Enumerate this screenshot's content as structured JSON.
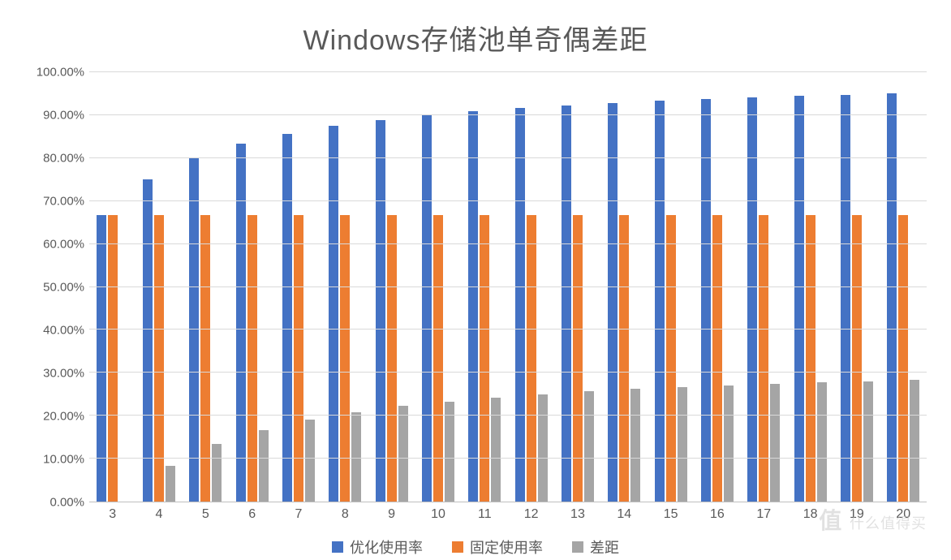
{
  "chart_data": {
    "type": "bar",
    "title": "Windows存储池单奇偶差距",
    "xlabel": "",
    "ylabel": "",
    "ylim": [
      0,
      100
    ],
    "y_ticks": [
      "0.00%",
      "10.00%",
      "20.00%",
      "30.00%",
      "40.00%",
      "50.00%",
      "60.00%",
      "70.00%",
      "80.00%",
      "90.00%",
      "100.00%"
    ],
    "categories": [
      "3",
      "4",
      "5",
      "6",
      "7",
      "8",
      "9",
      "10",
      "11",
      "12",
      "13",
      "14",
      "15",
      "16",
      "17",
      "18",
      "19",
      "20"
    ],
    "series": [
      {
        "name": "优化使用率",
        "color": "#4472c4",
        "values": [
          66.67,
          75.0,
          80.0,
          83.33,
          85.71,
          87.5,
          88.89,
          90.0,
          90.91,
          91.67,
          92.31,
          92.86,
          93.33,
          93.75,
          94.12,
          94.44,
          94.74,
          95.0
        ]
      },
      {
        "name": "固定使用率",
        "color": "#ed7d31",
        "values": [
          66.67,
          66.67,
          66.67,
          66.67,
          66.67,
          66.67,
          66.67,
          66.67,
          66.67,
          66.67,
          66.67,
          66.67,
          66.67,
          66.67,
          66.67,
          66.67,
          66.67,
          66.67
        ]
      },
      {
        "name": "差距",
        "color": "#a5a5a5",
        "values": [
          0.0,
          8.33,
          13.33,
          16.67,
          19.05,
          20.83,
          22.22,
          23.33,
          24.24,
          25.0,
          25.64,
          26.19,
          26.67,
          27.08,
          27.45,
          27.78,
          28.07,
          28.33
        ]
      }
    ],
    "legend_position": "bottom"
  },
  "watermark": {
    "brand": "值",
    "text": "什么值得买"
  }
}
